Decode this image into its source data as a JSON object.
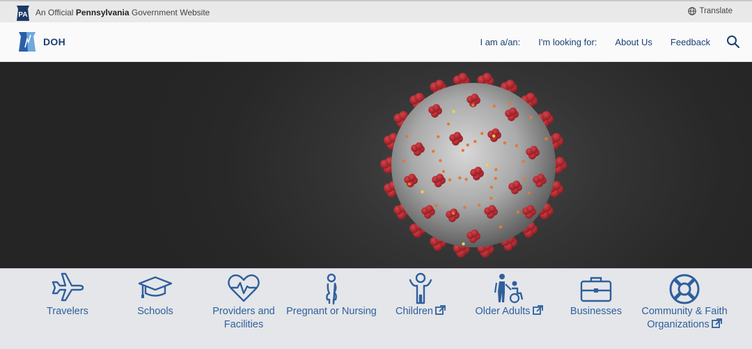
{
  "official_bar": {
    "badge": "PA",
    "text_prefix": "An Official ",
    "text_bold": "Pennsylvania",
    "text_suffix": " Government Website",
    "translate_label": "Translate"
  },
  "header": {
    "site_name": "DOH",
    "nav": [
      "I am a/an:",
      "I'm looking for:",
      "About Us",
      "Feedback"
    ]
  },
  "categories": [
    {
      "label": "Travelers",
      "icon": "airplane-icon",
      "external": false
    },
    {
      "label": "Schools",
      "icon": "graduation-cap-icon",
      "external": false
    },
    {
      "label": "Providers and Facilities",
      "icon": "heart-pulse-icon",
      "external": false
    },
    {
      "label": "Pregnant or Nursing",
      "icon": "pregnant-woman-icon",
      "external": false
    },
    {
      "label": "Children",
      "icon": "child-icon",
      "external": true
    },
    {
      "label": "Older Adults",
      "icon": "older-adults-icon",
      "external": true
    },
    {
      "label": "Businesses",
      "icon": "briefcase-icon",
      "external": false
    },
    {
      "label": "Community & Faith Organizations",
      "icon": "life-ring-icon",
      "external": true
    }
  ],
  "colors": {
    "link_blue": "#2f5f9e",
    "navy": "#1a3f73",
    "virus_red": "#b5222b"
  }
}
